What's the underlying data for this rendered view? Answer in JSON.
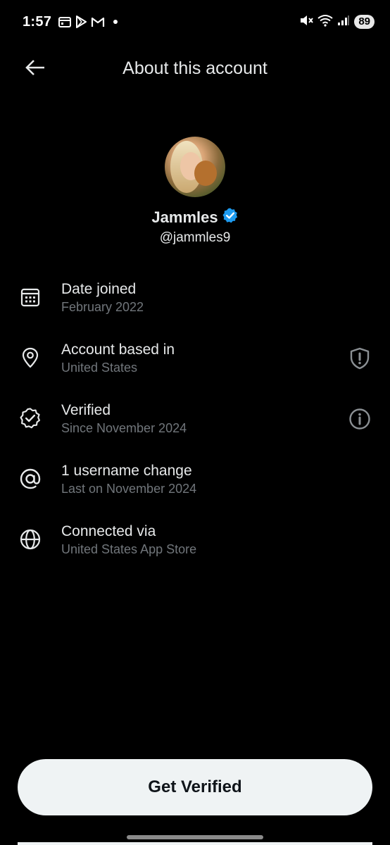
{
  "status_bar": {
    "time": "1:57",
    "battery": "89",
    "left_icons": [
      "calendar-icon",
      "play-store-icon",
      "gmail-icon",
      "dot-icon"
    ],
    "right_icons": [
      "mute-icon",
      "wifi-icon",
      "signal-icon"
    ]
  },
  "header": {
    "title": "About this account",
    "back_icon": "arrow-left-icon"
  },
  "profile": {
    "display_name": "Jammles",
    "handle": "@jammles9",
    "verified_badge": "verified-badge-icon",
    "badge_color": "#1d9bf0"
  },
  "info_items": [
    {
      "icon": "calendar-icon",
      "title": "Date joined",
      "subtitle": "February 2022",
      "action_icon": ""
    },
    {
      "icon": "location-pin-icon",
      "title": "Account based in",
      "subtitle": "United States",
      "action_icon": "shield-alert-icon"
    },
    {
      "icon": "verified-check-icon",
      "title": "Verified",
      "subtitle": "Since November 2024",
      "action_icon": "info-icon"
    },
    {
      "icon": "at-sign-icon",
      "title": "1 username change",
      "subtitle": "Last on November 2024",
      "action_icon": ""
    },
    {
      "icon": "globe-icon",
      "title": "Connected via",
      "subtitle": "United States App Store",
      "action_icon": ""
    }
  ],
  "cta": {
    "label": "Get Verified"
  },
  "colors": {
    "background": "#000000",
    "primary_text": "#e7e9ea",
    "secondary_text": "#71767b",
    "button_bg": "#eff3f4",
    "button_text": "#0f1419"
  }
}
